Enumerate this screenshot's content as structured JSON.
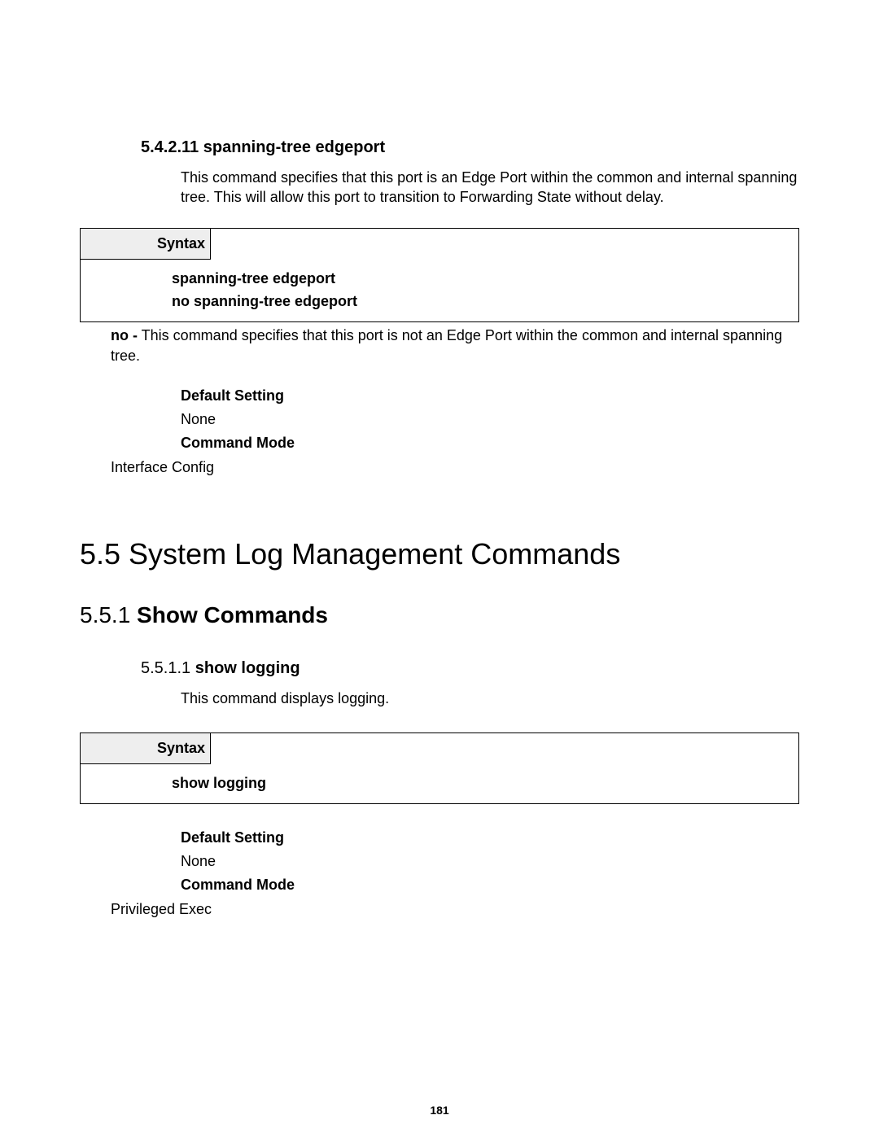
{
  "sec1": {
    "heading_num": "5.4.2.11",
    "heading_title": "spanning-tree edgeport",
    "desc": "This command specifies that this port is an Edge Port within the common and internal spanning tree. This will allow this port to transition to Forwarding State without delay.",
    "syntax_label": "Syntax",
    "syntax_line1": "spanning-tree edgeport",
    "syntax_line2": "no spanning-tree edgeport",
    "no_bold": "no -",
    "no_rest": " This command specifies that this port is not an Edge Port within the common and internal spanning tree.",
    "default_label": "Default Setting",
    "default_value": "None",
    "mode_label": "Command Mode",
    "mode_value": "Interface Config"
  },
  "sec2": {
    "h1_num": "5.5",
    "h1_title": " System Log Management Commands",
    "h2_num": "5.5.1",
    "h2_title": " Show Commands",
    "h3_num": "5.5.1.1",
    "h3_title": " show logging",
    "desc": "This command displays logging.",
    "syntax_label": "Syntax",
    "syntax_line1": "show logging",
    "default_label": "Default Setting",
    "default_value": "None",
    "mode_label": "Command Mode",
    "mode_value": "Privileged Exec"
  },
  "page_number": "181"
}
